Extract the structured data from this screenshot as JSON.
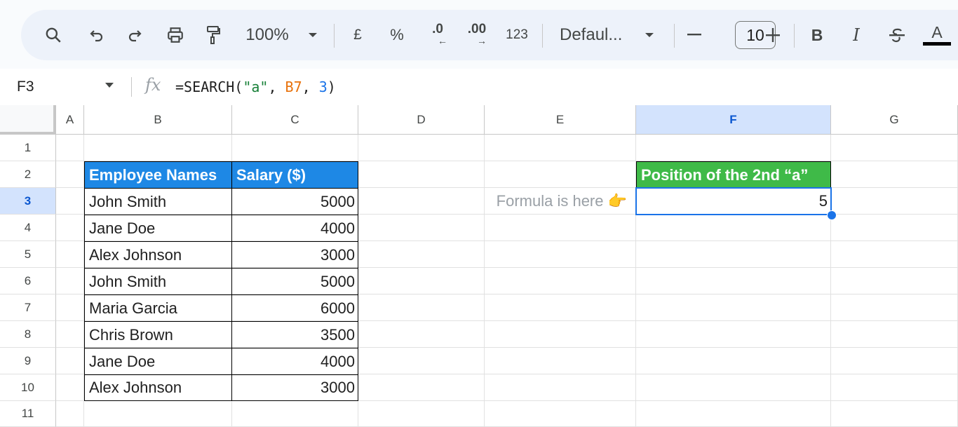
{
  "toolbar": {
    "zoom": "100%",
    "currency": "£",
    "percent": "%",
    "decrease_decimal": ".0",
    "increase_decimal": ".00",
    "number_format": "123",
    "font": "Defaul...",
    "font_size": "10",
    "bold": "B",
    "italic": "I",
    "text_color": "A"
  },
  "formula_bar": {
    "cell_ref": "F3",
    "formula_prefix": "=SEARCH(",
    "formula_arg1": "\"a\"",
    "formula_sep1": ", ",
    "formula_arg2": "B7",
    "formula_sep2": ", ",
    "formula_arg3": "3",
    "formula_suffix": ")"
  },
  "columns": [
    "A",
    "B",
    "C",
    "D",
    "E",
    "F",
    "G"
  ],
  "rows": [
    "1",
    "2",
    "3",
    "4",
    "5",
    "6",
    "7",
    "8",
    "9",
    "10",
    "11"
  ],
  "sheet": {
    "table_headers": [
      "Employee Names",
      "Salary ($)"
    ],
    "employees": [
      {
        "name": "John Smith",
        "salary": "5000"
      },
      {
        "name": "Jane Doe",
        "salary": "4000"
      },
      {
        "name": "Alex Johnson",
        "salary": "3000"
      },
      {
        "name": "John Smith",
        "salary": "5000"
      },
      {
        "name": "Maria Garcia",
        "salary": "6000"
      },
      {
        "name": "Chris Brown",
        "salary": "3500"
      },
      {
        "name": "Jane Doe",
        "salary": "4000"
      },
      {
        "name": "Alex Johnson",
        "salary": "3000"
      }
    ],
    "result_header": "Position of the 2nd “a”",
    "result_value": "5",
    "note": "Formula is here 👉"
  },
  "colors": {
    "table_header_bg": "#1e88e5",
    "result_header_bg": "#3fba48",
    "selection": "#1a73e8",
    "toolbar_bg": "#edf2fa"
  }
}
